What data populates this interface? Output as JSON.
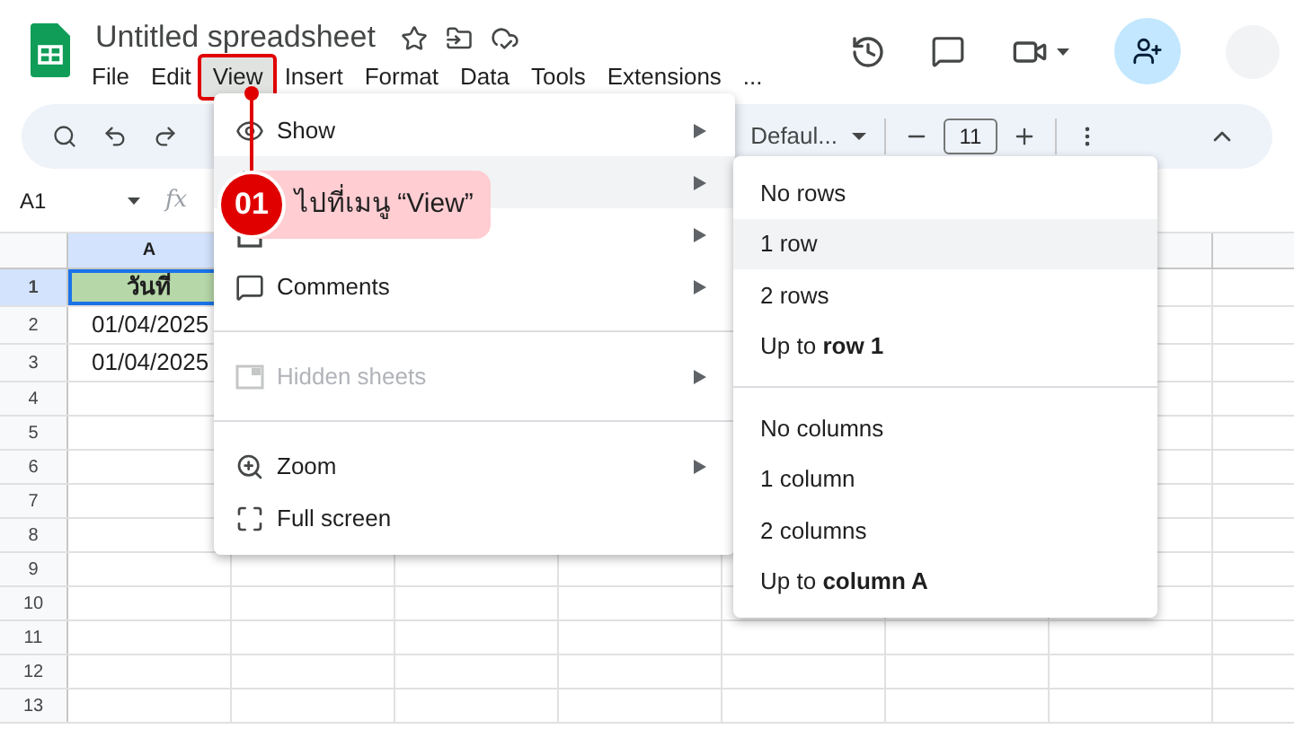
{
  "app": {
    "title": "Untitled spreadsheet"
  },
  "menu_bar": [
    {
      "label": "File",
      "selected": false
    },
    {
      "label": "Edit",
      "selected": false
    },
    {
      "label": "View",
      "selected": true
    },
    {
      "label": "Insert",
      "selected": false
    },
    {
      "label": "Format",
      "selected": false
    },
    {
      "label": "Data",
      "selected": false
    },
    {
      "label": "Tools",
      "selected": false
    },
    {
      "label": "Extensions",
      "selected": false
    },
    {
      "label": "...",
      "selected": false
    }
  ],
  "toolbar": {
    "font": "Defaul...",
    "font_size": "11"
  },
  "formula_bar": {
    "name_box": "A1",
    "fx": "fx"
  },
  "sheet": {
    "columns": [
      {
        "label": "A",
        "selected": true
      }
    ],
    "rows": [
      {
        "label": "1",
        "selected": true,
        "cells": [
          "วันที่"
        ]
      },
      {
        "label": "2",
        "selected": false,
        "cells": [
          "01/04/2025"
        ]
      },
      {
        "label": "3",
        "selected": false,
        "cells": [
          "01/04/2025"
        ]
      },
      {
        "label": "4",
        "selected": false,
        "cells": []
      },
      {
        "label": "5",
        "selected": false,
        "cells": []
      },
      {
        "label": "6",
        "selected": false,
        "cells": []
      },
      {
        "label": "7",
        "selected": false,
        "cells": []
      },
      {
        "label": "8",
        "selected": false,
        "cells": []
      },
      {
        "label": "9",
        "selected": false,
        "cells": []
      },
      {
        "label": "10",
        "selected": false,
        "cells": []
      },
      {
        "label": "11",
        "selected": false,
        "cells": []
      },
      {
        "label": "12",
        "selected": false,
        "cells": []
      },
      {
        "label": "13",
        "selected": false,
        "cells": []
      }
    ]
  },
  "view_menu": {
    "items": [
      {
        "kind": "item",
        "label": "Show",
        "submenu": true,
        "selected": false,
        "disabled": false
      },
      {
        "kind": "item",
        "submenu": true,
        "selected": true
      },
      {
        "kind": "item",
        "submenu": true,
        "selected": false
      },
      {
        "kind": "item",
        "label": "Comments",
        "submenu": true,
        "selected": false,
        "disabled": false
      },
      {
        "kind": "divider"
      },
      {
        "kind": "item",
        "label": "Hidden sheets",
        "submenu": true,
        "selected": false,
        "disabled": true
      },
      {
        "kind": "divider"
      },
      {
        "kind": "item",
        "label": "Zoom",
        "submenu": true,
        "selected": false,
        "disabled": false
      },
      {
        "kind": "item",
        "label": "Full screen",
        "submenu": false,
        "selected": false,
        "disabled": false
      }
    ]
  },
  "submenu": {
    "items": [
      {
        "kind": "item",
        "label": "No rows",
        "selected": false
      },
      {
        "kind": "item",
        "label": "1 row",
        "selected": true
      },
      {
        "kind": "item",
        "label": "2 rows",
        "selected": false
      },
      {
        "kind": "item",
        "label": "Up to **row 1**",
        "selected": false
      },
      {
        "kind": "divider"
      },
      {
        "kind": "item",
        "label": "No columns",
        "selected": false
      },
      {
        "kind": "item",
        "label": "1 column",
        "selected": false
      },
      {
        "kind": "item",
        "label": "2 columns",
        "selected": false
      },
      {
        "kind": "item",
        "label": "Up to **column A**",
        "selected": false
      }
    ]
  },
  "callout": {
    "number": "01",
    "text": "ไปที่เมนู “View”"
  }
}
